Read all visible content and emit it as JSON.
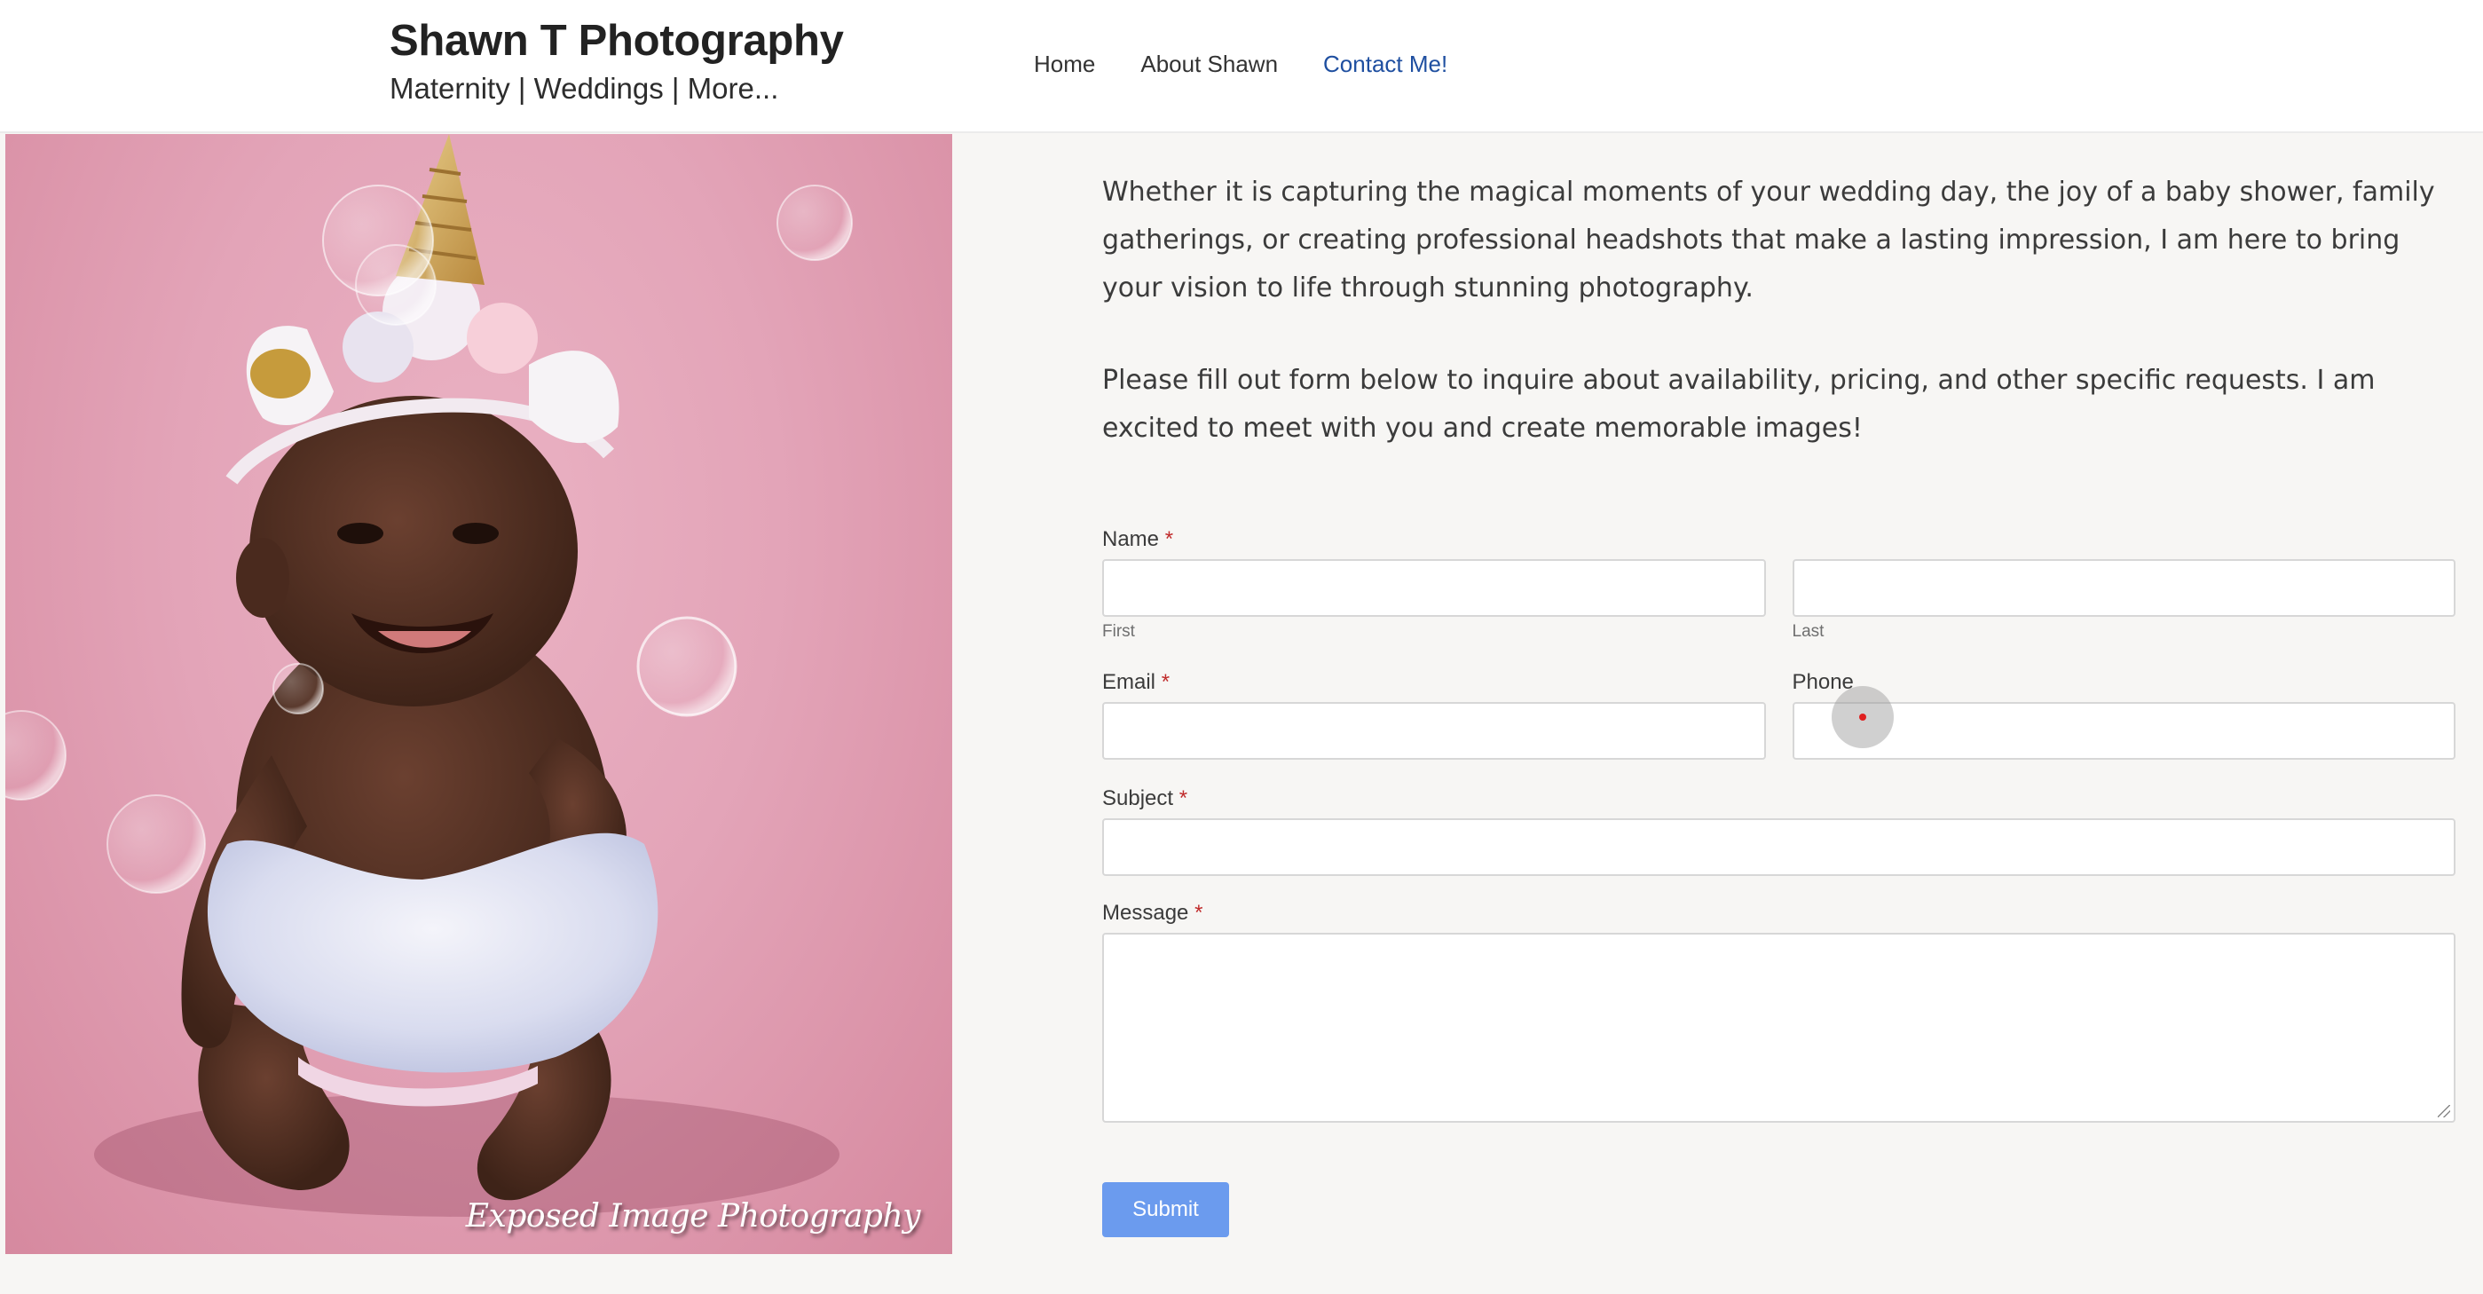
{
  "header": {
    "site_title": "Shawn T Photography",
    "tagline": "Maternity | Weddings | More...",
    "nav": [
      {
        "label": "Home"
      },
      {
        "label": "About Shawn"
      },
      {
        "label": "Contact Me!",
        "active": true
      }
    ]
  },
  "photo": {
    "watermark": "Exposed Image Photography"
  },
  "content": {
    "paragraph_1": "Whether it is capturing the magical moments of your wedding day, the joy of a baby shower, family gatherings, or creating professional headshots that make a lasting impression, I am here to bring your vision to life through stunning photography.",
    "paragraph_2": "Please fill out form below to inquire about availability, pricing, and other specific requests.  I am excited to meet with you and create memorable images!"
  },
  "form": {
    "name_label": "Name",
    "required_mark": "*",
    "first_sublabel": "First",
    "last_sublabel": "Last",
    "email_label": "Email",
    "phone_label": "Phone",
    "subject_label": "Subject",
    "message_label": "Message",
    "submit_label": "Submit"
  },
  "colors": {
    "page_bg": "#f7f6f4",
    "nav_active": "#1f4fa0",
    "submit_bg": "#6b9bee",
    "required": "#c02b2b",
    "photo_bg": "#e3a4b8"
  }
}
